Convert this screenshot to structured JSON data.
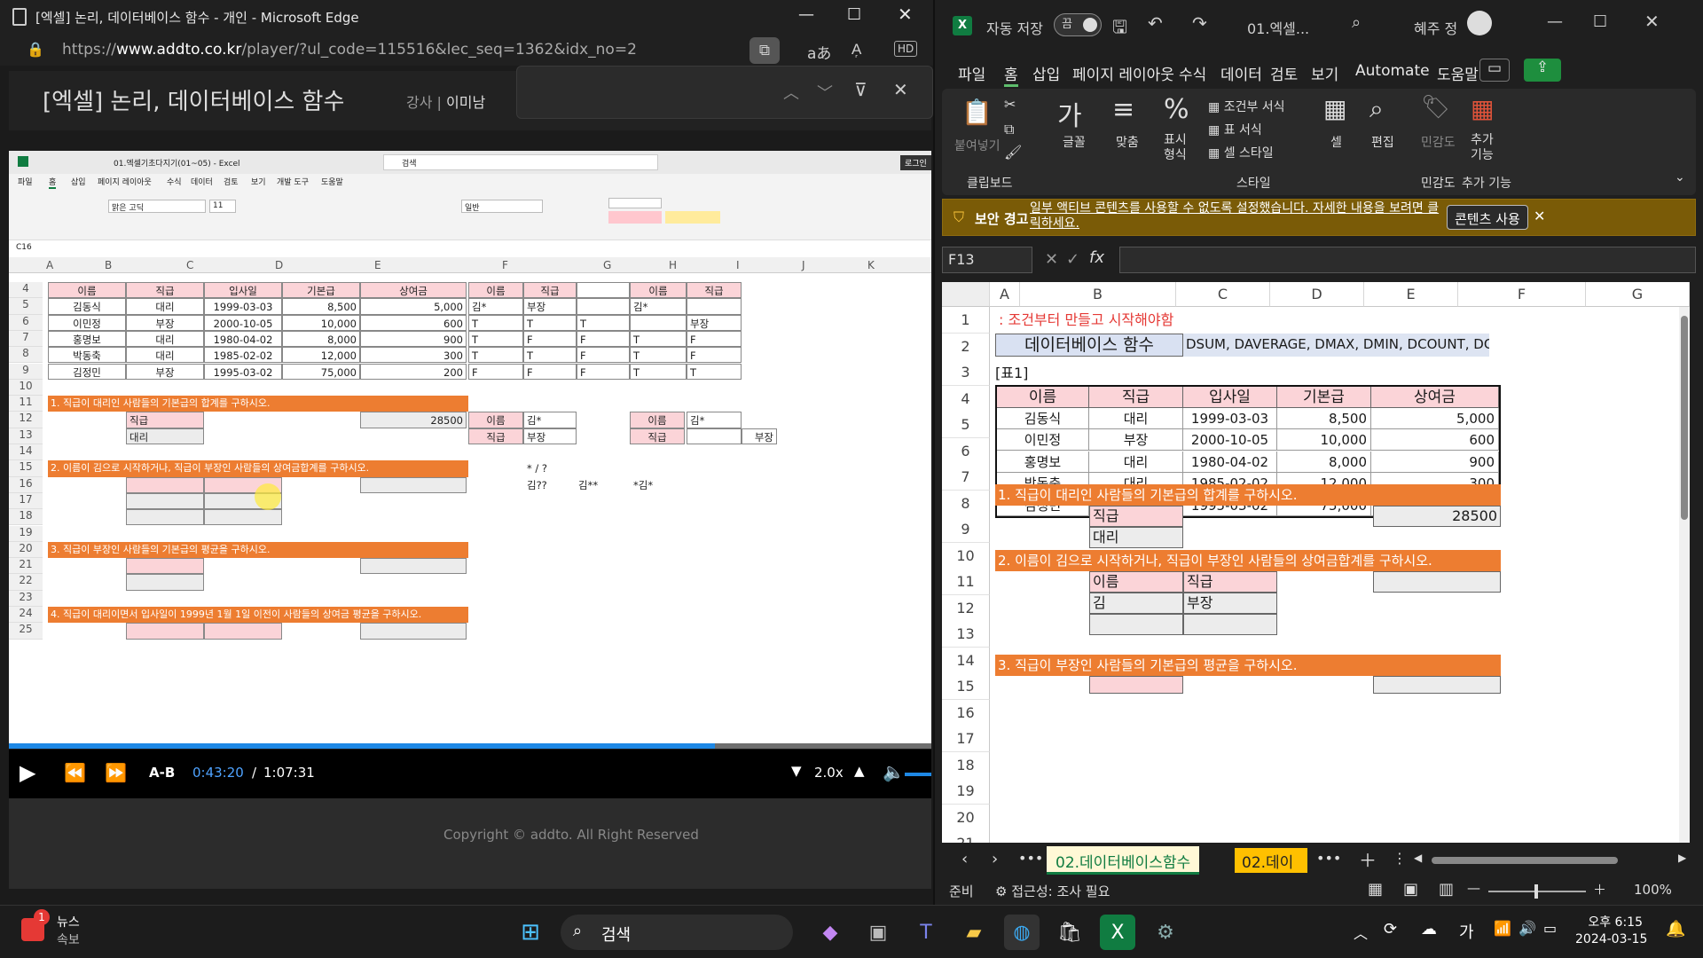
{
  "edge": {
    "tab_title": "[엑셀] 논리, 데이터베이스 함수 - 개인 - Microsoft Edge",
    "url_prefix": "https://",
    "url_host": "www.addto.co.kr",
    "url_path": "/player/?ul_code=115516&lec_seq=1362&idx_no=2",
    "player_title": "[엑셀] 논리, 데이터베이스 함수",
    "teacher_label": "강사",
    "teacher_name": "이미남",
    "time_current": "0:43:20",
    "time_sep": "/",
    "time_total": "1:07:31",
    "ab_label": "A-B",
    "speed": "2.0x",
    "copyright": "Copyright © addto. All Right Reserved"
  },
  "video_excel": {
    "file_title": "01.엑셀기초다지기(01~05) - Excel",
    "search_placeholder": "검색",
    "login": "로그인",
    "menu": [
      "파일",
      "홈",
      "삽입",
      "페이지 레이아웃",
      "수식",
      "데이터",
      "검토",
      "보기",
      "개발 도구",
      "도움말"
    ],
    "name_box": "C16",
    "font_name": "맑은 고딕",
    "font_size": "11",
    "number_format": "일반",
    "cols": [
      "A",
      "B",
      "C",
      "D",
      "E",
      "F",
      "G",
      "H",
      "I",
      "J",
      "K"
    ],
    "rows": [
      {
        "n": "4",
        "cells": [
          "이름",
          "직급",
          "입사일",
          "기본급",
          "상여금",
          "이름",
          "직급",
          "",
          "이름",
          "직급"
        ]
      },
      {
        "n": "5",
        "cells": [
          "김동식",
          "대리",
          "1999-03-03",
          "8,500",
          "5,000",
          "김*",
          "부장",
          "",
          "김*",
          ""
        ]
      },
      {
        "n": "6",
        "cells": [
          "이민정",
          "부장",
          "2000-10-05",
          "10,000",
          "600",
          "T",
          "T",
          "T",
          "",
          "부장"
        ]
      },
      {
        "n": "7",
        "cells": [
          "홍명보",
          "대리",
          "1980-04-02",
          "8,000",
          "900",
          "T",
          "F",
          "F",
          "T",
          "F"
        ]
      },
      {
        "n": "8",
        "cells": [
          "박동축",
          "대리",
          "1985-02-02",
          "12,000",
          "300",
          "T",
          "T",
          "F",
          "T",
          "F"
        ]
      },
      {
        "n": "9",
        "cells": [
          "김정민",
          "부장",
          "1995-03-02",
          "75,000",
          "200",
          "F",
          "F",
          "F",
          "T",
          "T"
        ]
      }
    ],
    "q1": "1. 직급이 대리인 사람들의 기본급의 합계를 구하시오.",
    "q2": "2. 이름이 김으로 시작하거나, 직급이 부장인 사람들의 상여금합계를 구하시오.",
    "q3": "3. 직급이 부장인 사람들의 기본급의 평균을 구하시오.",
    "q4": "4. 직급이 대리이면서 입사일이 1999년 1월 1일 이전이 사람들의 상여금 평균을 구하시오.",
    "q1_label": "직급",
    "q1_value": "대리",
    "q1_result": "28500",
    "crit_name": "이름",
    "crit_name_val": "김*",
    "crit_rank": "직급",
    "crit_rank_val": "부장",
    "wild1": "* / ?",
    "wild2": "김??",
    "wild3": "김**",
    "wild4": "*김*",
    "extra_rows": [
      "10",
      "11",
      "12",
      "13",
      "14",
      "15",
      "16",
      "17",
      "18",
      "19",
      "20",
      "21",
      "22",
      "23",
      "24",
      "25"
    ]
  },
  "excel": {
    "autosave_label": "자동 저장",
    "autosave_state": "끔",
    "file_name": "01.엑셀...",
    "user": "혜주 정",
    "menu": [
      "파일",
      "홈",
      "삽입",
      "페이지 레이아웃",
      "수식",
      "데이터",
      "검토",
      "보기",
      "Automate",
      "도움말"
    ],
    "ribbon": {
      "paste": "붙여넣기",
      "clipboard": "클립보드",
      "font": "글꼴",
      "align": "맞춤",
      "number": "표시\n형식",
      "cond_format": "조건부 서식",
      "table_format": "표 서식",
      "cell_style": "셀 스타일",
      "style_group": "스타일",
      "cells": "셀",
      "edit": "편집",
      "sensitivity": "민감도",
      "sensitivity_group": "민감도",
      "addins": "추가\n기능",
      "addins_group": "추가 기능"
    },
    "warning_label": "보안 경고",
    "warning_text": "일부 액티브 콘텐츠를 사용할 수 없도록 설정했습니다. 자세한 내용을 보려면 클릭하세요.",
    "warning_button": "콘텐츠 사용",
    "name_box": "F13",
    "cols": [
      "A",
      "B",
      "C",
      "D",
      "E",
      "F",
      "G"
    ],
    "r1": ": 조건부터 만들고 시작해야함",
    "r2_title": "데이터베이스 함수",
    "r2_funcs": "DSUM, DAVERAGE, DMAX, DMIN, DCOUNT, DCOUNTA",
    "r3": "[표1]",
    "table_headers": [
      "이름",
      "직급",
      "입사일",
      "기본급",
      "상여금"
    ],
    "table_rows": [
      [
        "김동식",
        "대리",
        "1999-03-03",
        "8,500",
        "5,000"
      ],
      [
        "이민정",
        "부장",
        "2000-10-05",
        "10,000",
        "600"
      ],
      [
        "홍명보",
        "대리",
        "1980-04-02",
        "8,000",
        "900"
      ],
      [
        "박동축",
        "대리",
        "1985-02-02",
        "12,000",
        "300"
      ],
      [
        "김정민",
        "부장",
        "1995-03-02",
        "75,000",
        "200"
      ]
    ],
    "q1": "1. 직급이 대리인 사람들의 기본급의 합계를 구하시오.",
    "q1_label": "직급",
    "q1_value": "대리",
    "q1_result": "28500",
    "q2": "2. 이름이 김으로 시작하거나, 직급이 부장인 사람들의 상여금합계를 구하시오.",
    "q2_h1": "이름",
    "q2_h2": "직급",
    "q2_v1": "김",
    "q2_v2": "부장",
    "q3": "3. 직급이 부장인 사람들의 기본급의 평균을 구하시오.",
    "row_numbers": [
      "1",
      "2",
      "3",
      "4",
      "5",
      "6",
      "7",
      "8",
      "9",
      "10",
      "11",
      "12",
      "13",
      "14",
      "15",
      "16",
      "17",
      "18",
      "19",
      "20",
      "21"
    ],
    "sheet_tab_active": "02.데이터베이스함수",
    "sheet_tab_next": "02.데이터",
    "status_ready": "준비",
    "status_access": "접근성: 조사 필요",
    "zoom": "100%"
  },
  "taskbar": {
    "news_badge": "1",
    "news_label": "뉴스",
    "news_sub": "속보",
    "search": "검색",
    "time": "오후 6:15",
    "date": "2024-03-15",
    "ime": "가"
  },
  "colors": {
    "accent_orange": "#ed7d31",
    "header_pink": "#fbd4d8",
    "excel_green": "#107c41",
    "progress_blue": "#1e88e5"
  }
}
